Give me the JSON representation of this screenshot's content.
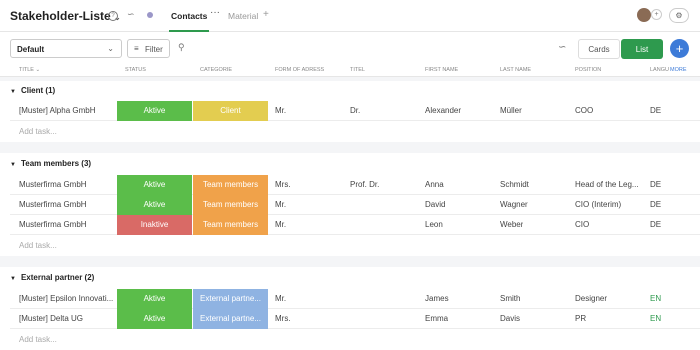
{
  "header": {
    "title": "Stakeholder-Liste",
    "tabs": [
      {
        "label": "Contacts"
      },
      {
        "label": "Material"
      }
    ],
    "add_tab": "+"
  },
  "toolbar": {
    "view_select": "Default",
    "filter_label": "Filter",
    "cards_label": "Cards",
    "list_label": "List",
    "add_label": "+"
  },
  "columns": [
    "Title",
    "Status",
    "Categorie",
    "Form of adress",
    "Titel",
    "First name",
    "Last name",
    "Position",
    "Langu",
    "More"
  ],
  "groups": [
    {
      "label": "Client (1)",
      "rows": [
        {
          "title": "[Muster] Alpha GmbH",
          "status": "Aktive",
          "category": "Client",
          "form": "Mr.",
          "titel": "Dr.",
          "first": "Alexander",
          "last": "Müller",
          "position": "COO",
          "lang": "DE"
        }
      ],
      "add_task": "Add task..."
    },
    {
      "label": "Team members (3)",
      "rows": [
        {
          "title": "Musterfirma GmbH",
          "status": "Aktive",
          "category": "Team members",
          "form": "Mrs.",
          "titel": "Prof. Dr.",
          "first": "Anna",
          "last": "Schmidt",
          "position": "Head of the Leg...",
          "lang": "DE"
        },
        {
          "title": "Musterfirma GmbH",
          "status": "Aktive",
          "category": "Team members",
          "form": "Mr.",
          "titel": "",
          "first": "David",
          "last": "Wagner",
          "position": "CIO (Interim)",
          "lang": "DE"
        },
        {
          "title": "Musterfirma GmbH",
          "status": "Inaktive",
          "category": "Team members",
          "form": "Mr.",
          "titel": "",
          "first": "Leon",
          "last": "Weber",
          "position": "CIO",
          "lang": "DE"
        }
      ],
      "add_task": "Add task..."
    },
    {
      "label": "External partner (2)",
      "rows": [
        {
          "title": "[Muster] Epsilon Innovati...",
          "status": "Aktive",
          "category": "External partne...",
          "form": "Mr.",
          "titel": "",
          "first": "James",
          "last": "Smith",
          "position": "Designer",
          "lang": "EN"
        },
        {
          "title": "[Muster] Delta UG",
          "status": "Aktive",
          "category": "External partne...",
          "form": "Mrs.",
          "titel": "",
          "first": "Emma",
          "last": "Davis",
          "position": "PR",
          "lang": "EN"
        }
      ],
      "add_task": "Add task..."
    }
  ],
  "colors": {
    "active": "#5bbd4a",
    "inactive": "#d96a66",
    "client": "#e3cd50",
    "team": "#f0a24a",
    "external": "#8fb3e2",
    "accent": "#2e9a4e",
    "add": "#3d7bd8"
  }
}
